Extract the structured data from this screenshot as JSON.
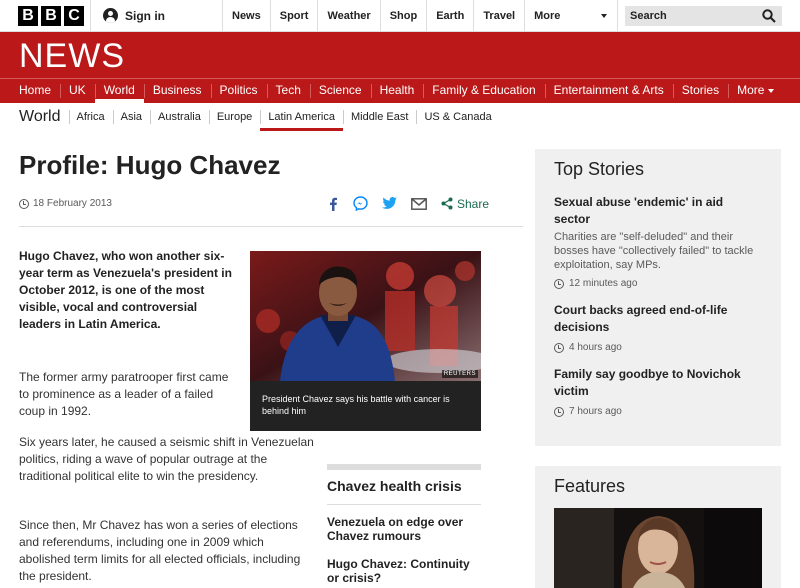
{
  "global_nav": {
    "logo_letters": [
      "B",
      "B",
      "C"
    ],
    "sign_in": "Sign in",
    "items": [
      "News",
      "Sport",
      "Weather",
      "Shop",
      "Earth",
      "Travel"
    ],
    "more": "More",
    "search_placeholder": "Search"
  },
  "news_header": {
    "title": "NEWS",
    "nav": [
      "Home",
      "UK",
      "World",
      "Business",
      "Politics",
      "Tech",
      "Science",
      "Health",
      "Family & Education",
      "Entertainment & Arts",
      "Stories"
    ],
    "nav_active": "World",
    "more": "More",
    "brand_color": "#bb1919"
  },
  "section_nav": {
    "title": "World",
    "items": [
      "Africa",
      "Asia",
      "Australia",
      "Europe",
      "Latin America",
      "Middle East",
      "US & Canada"
    ],
    "active": "Latin America"
  },
  "story": {
    "title": "Profile: Hugo Chavez",
    "date": "18 February 2013",
    "share_label": "Share",
    "intro": "Hugo Chavez, who won another six-year term as Venezuela's president in October 2012, is one of the most visible, vocal and controversial leaders in Latin America.",
    "paragraphs": [
      "The former army paratrooper first came to prominence as a leader of a failed coup in 1992.",
      "Six years later, he caused a seismic shift in Venezuelan politics, riding a wave of popular outrage at the traditional political elite to win the presidency.",
      "Since then, Mr Chavez has won a series of elections and referendums, including one in 2009 which abolished term limits for all elected officials, including the president."
    ],
    "image": {
      "credit": "REUTERS",
      "caption": "President Chavez says his battle with cancer is behind him"
    },
    "related": {
      "title": "Chavez health crisis",
      "links": [
        "Venezuela on edge over Chavez rumours",
        "Hugo Chavez: Continuity or crisis?"
      ]
    }
  },
  "top_stories": {
    "title": "Top Stories",
    "items": [
      {
        "headline": "Sexual abuse 'endemic' in aid sector",
        "summary": "Charities are \"self-deluded\" and their bosses have \"collectively failed\" to tackle exploitation, say MPs.",
        "time": "12 minutes ago"
      },
      {
        "headline": "Court backs agreed end-of-life decisions",
        "summary": "",
        "time": "4 hours ago"
      },
      {
        "headline": "Family say goodbye to Novichok victim",
        "summary": "",
        "time": "7 hours ago"
      }
    ]
  },
  "features": {
    "title": "Features"
  }
}
